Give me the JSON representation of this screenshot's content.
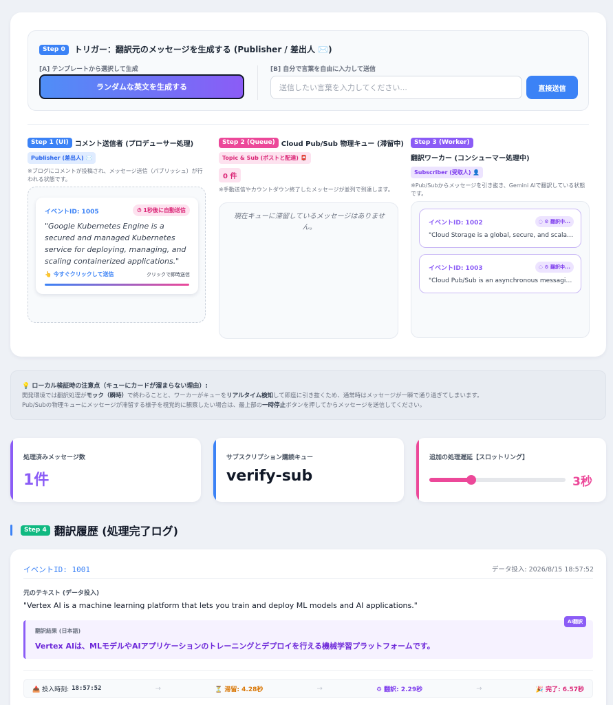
{
  "step0": {
    "badge": "Step 0",
    "title": "トリガー：翻訳元のメッセージを生成する (Publisher / 差出人 ✉️)",
    "label_a": "[A] テンプレートから選択して生成",
    "generate_button": "ランダムな英文を生成する",
    "label_b": "[B] 自分で言葉を自由に入力して送信",
    "input_placeholder": "送信したい言葉を入力してください...",
    "send_button": "直接送信"
  },
  "step1": {
    "badge": "Step 1 (UI)",
    "title": "コメント送信者 (プロデューサー処理)",
    "role_pill": "Publisher (差出人) ✉️",
    "note": "※ブログにコメントが投稿され、メッセージ送信（パブリッシュ）が行われる状態です。",
    "card": {
      "event_id": "イベントID: 1005",
      "auto_send": "⏱ 1秒後に自動送信",
      "text": "\"Google Kubernetes Engine is a secured and managed Kubernetes service for deploying, managing, and scaling containerized applications.\"",
      "click_now": "👆 今すぐクリックして送信",
      "click_hint": "クリックで即時送信",
      "progress": 1.0
    }
  },
  "step2": {
    "badge": "Step 2 (Queue)",
    "title": "Cloud Pub/Sub 物理キュー (滞留中)",
    "role_pill": "Topic & Sub (ポストと配達) 📮",
    "count": "0 件",
    "note": "※手動送信やカウントダウン終了したメッセージが並列で到達します。",
    "empty_text": "現在キューに滞留しているメッセージはありません。"
  },
  "step3": {
    "badge": "Step 3 (Worker)",
    "title": "翻訳ワーカー (コンシューマー処理中)",
    "role_pill": "Subscriber (受取人) 👤",
    "note": "※Pub/Subからメッセージを引き抜き、Gemini AIで翻訳している状態です。",
    "cards": [
      {
        "event_id": "イベントID: 1002",
        "status": "◌ ⚙ 翻訳中...",
        "text": "\"Cloud Storage is a global, secure, and scalable object storage service.\""
      },
      {
        "event_id": "イベントID: 1003",
        "status": "◌ ⚙ 翻訳中...",
        "text": "\"Cloud Pub/Sub is an asynchronous messaging service.\""
      }
    ]
  },
  "notice": {
    "title": "💡 ローカル検証時の注意点（キューにカードが溜まらない理由）:",
    "line1_a": "開発環境では翻訳処理が",
    "line1_b": "モック（瞬時）",
    "line1_c": "で終わることと、ワーカーがキューを",
    "line1_d": "リアルタイム検知",
    "line1_e": "して即座に引き抜くため、通常時はメッセージが一瞬で通り過ぎてしまいます。",
    "line2_a": "Pub/Subの物理キューにメッセージが滞留する様子を視覚的に観察したい場合は、最上部の",
    "line2_b": "一時停止",
    "line2_c": "ボタンを押してからメッセージを送信してください。"
  },
  "stats": {
    "processed": {
      "label": "処理済みメッセージ数",
      "value": "1件",
      "color": "#8b5cf6"
    },
    "subscription": {
      "label": "サブスクリプション購読キュー",
      "value": "verify-sub",
      "color": "#3b82f6"
    },
    "throttle": {
      "label": "追加の処理遅延【スロットリング】",
      "value": "3秒",
      "level": 0.31,
      "color": "#ec4899"
    }
  },
  "step4": {
    "badge": "Step 4",
    "title": "翻訳履歴 (処理完了ログ)"
  },
  "history": [
    {
      "event_id": "イベントID: 1001",
      "timestamp": "データ投入: 2026/8/15 18:57:52",
      "source_label": "元のテキスト (データ投入)",
      "source_text": "\"Vertex AI is a machine learning platform that lets you train and deploy ML models and AI applications.\"",
      "translation_label": "翻訳結果 (日本語)",
      "ai_badge": "AI翻訳",
      "translation_text": "Vertex AIは、MLモデルやAIアプリケーションのトレーニングとデプロイを行える機械学習プラットフォームです。",
      "footer": {
        "input_label": "📥 投入時刻:",
        "input_time": "18:57:52",
        "wait": "⏳ 滞留: 4.28秒",
        "translate": "⚙ 翻訳: 2.29秒",
        "done": "🎉 完了: 6.57秒"
      }
    }
  ]
}
